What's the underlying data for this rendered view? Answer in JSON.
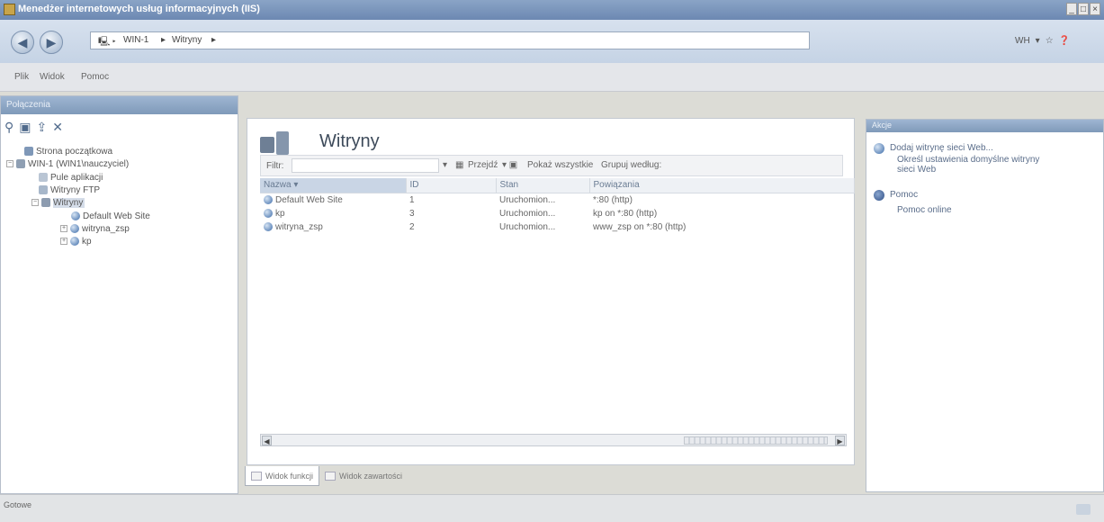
{
  "window": {
    "title": "Menedżer internetowych usług informacyjnych (IIS)",
    "controls": [
      "_",
      "□",
      "×"
    ]
  },
  "address": {
    "crumbs": [
      "WIN-1",
      "Witryny"
    ],
    "right_tools": [
      "WH",
      "▾",
      "☆",
      "❓"
    ]
  },
  "menu": [
    "Plik",
    "Widok",
    "Pomoc"
  ],
  "left": {
    "header": "Połączenia",
    "tree": [
      {
        "label": "Strona początkowa"
      },
      {
        "label": "WIN-1 (WIN1\\nauczyciel)"
      },
      {
        "label": "Pule aplikacji"
      },
      {
        "label": "Witryny FTP"
      },
      {
        "label": "Witryny"
      },
      {
        "label": "Default Web Site"
      },
      {
        "label": "witryna_zsp"
      },
      {
        "label": "kp"
      }
    ]
  },
  "center": {
    "title": "Witryny",
    "filter_label": "Filtr:",
    "go_label": "Przejdź",
    "show_all_label": "Pokaż wszystkie",
    "group_label": "Grupuj według:",
    "columns": [
      "Nazwa",
      "ID",
      "Stan",
      "Powiązania"
    ],
    "rows": [
      {
        "name": "Default Web Site",
        "id": "1",
        "state": "Uruchomion...",
        "binding": "*:80 (http)"
      },
      {
        "name": "kp",
        "id": "3",
        "state": "Uruchomion...",
        "binding": "kp on *:80 (http)"
      },
      {
        "name": "witryna_zsp",
        "id": "2",
        "state": "Uruchomion...",
        "binding": "www_zsp on *:80 (http)"
      }
    ],
    "tabs": [
      "Widok funkcji",
      "Widok zawartości"
    ]
  },
  "right": {
    "header": "Akcje",
    "actions": [
      {
        "label": "Dodaj witrynę sieci Web..."
      },
      {
        "label": "Określ ustawienia domyślne witryny sieci Web"
      },
      {
        "label": "Pomoc"
      },
      {
        "label": "Pomoc online"
      }
    ]
  },
  "status": {
    "text": "Gotowe"
  }
}
